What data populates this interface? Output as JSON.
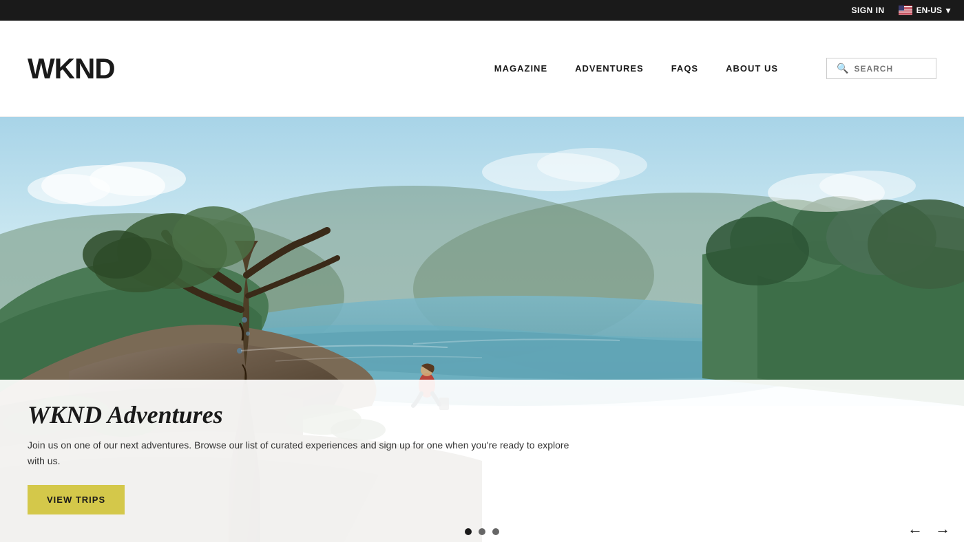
{
  "topbar": {
    "sign_in_label": "SIGN IN",
    "language_label": "EN-US",
    "language_chevron": "▾"
  },
  "header": {
    "logo": "WKND",
    "nav": {
      "items": [
        {
          "label": "MAGAZINE",
          "id": "magazine"
        },
        {
          "label": "ADVENTURES",
          "id": "adventures"
        },
        {
          "label": "FAQS",
          "id": "faqs"
        },
        {
          "label": "ABOUT US",
          "id": "about-us"
        }
      ]
    },
    "search": {
      "placeholder": "SEARCH",
      "icon": "🔍"
    }
  },
  "hero": {
    "title": "WKND Adventures",
    "description": "Join us on one of our next adventures. Browse our list of curated experiences and sign up for one when you're ready to explore with us.",
    "cta_label": "VIEW TRIPS",
    "dots": [
      {
        "active": true
      },
      {
        "active": false
      },
      {
        "active": false
      }
    ],
    "arrow_prev": "←",
    "arrow_next": "→"
  }
}
